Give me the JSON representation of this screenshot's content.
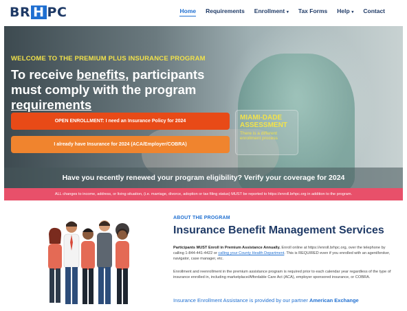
{
  "header": {
    "logo": {
      "left": "BR",
      "mid": "H",
      "right": "PC"
    },
    "nav": [
      {
        "label": "Home",
        "active": true,
        "dropdown": false
      },
      {
        "label": "Requirements",
        "active": false,
        "dropdown": false
      },
      {
        "label": "Enrollment",
        "active": false,
        "dropdown": true
      },
      {
        "label": "Tax Forms",
        "active": false,
        "dropdown": false
      },
      {
        "label": "Help",
        "active": false,
        "dropdown": true
      },
      {
        "label": "Contact",
        "active": false,
        "dropdown": false
      }
    ]
  },
  "hero": {
    "kicker": "WELCOME TO THE PREMIUM PLUS INSURANCE PROGRAM",
    "title_part1": "To receive ",
    "title_link1": "benefits",
    "title_part2": ", participants must comply with the program ",
    "title_link2": "requirements",
    "open_enrollment_button": "OPEN ENROLLMENT: I need an Insurance Policy for 2024",
    "already_have_button": "I already have Insurance for 2024 (ACA/Employer/COBRA)",
    "miami_title": "MIAMI-DADE ASSESSMENT",
    "miami_sub": "There is a different enrollment process",
    "verify": "Have you recently renewed your program eligibility? Verify your coverage for 2024"
  },
  "notice": "ALL changes to income, address, or living situation, (i.e. marriage, divorce, adoption or tax filing status) MUST be reported to https://enroll.brhpc.org in addition to the program.",
  "about": {
    "kicker": "ABOUT THE PROGRAM",
    "title": "Insurance Benefit Management Services",
    "p1_bold": "Participants MUST Enroll in Premium Assistance Annually.",
    "p1_a": " Enroll online at https://enroll.brhpc.org, over the telephone by calling 1-844-441-4422 or ",
    "p1_link": "calling your County Health Department",
    "p1_b": ". This is REQUIRED even if you enrolled with an agent/broker, navigator, case manager, etc.",
    "p2": "Enrollment and reenrollment in the premium assistance program is required prior to each calendar year regardless of the type of insurance enrolled in, including marketplace/Affordable Care Act (ACA), employer sponsored insurance, or COBRA.",
    "assist_text": "Insurance Enrollment Assistance is provided by our partner ",
    "assist_partner": "American Exchange"
  },
  "colors": {
    "brand_navy": "#1f3a66",
    "brand_blue": "#1f6fd1",
    "orange_dark": "#e84a17",
    "orange_light": "#f0842e",
    "notice_pink": "#e8506a",
    "accent_yellow": "#f2e24a"
  },
  "icons": {
    "dropdown": "chevron-down-icon",
    "illustration": "people-group-illustration"
  }
}
